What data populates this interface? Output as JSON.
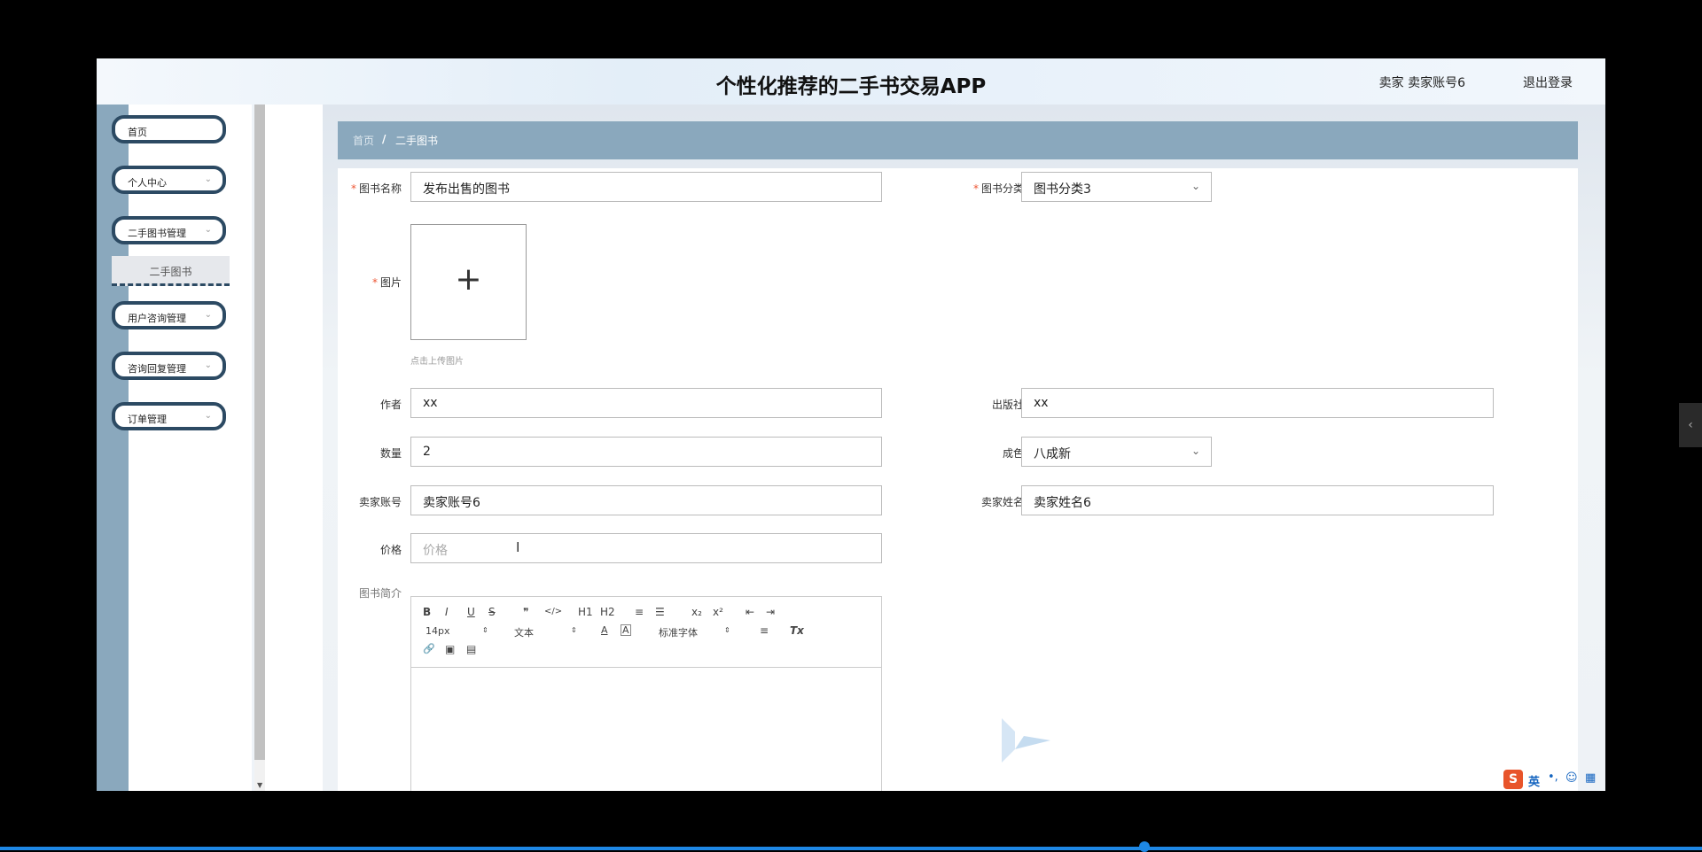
{
  "header": {
    "title": "个性化推荐的二手书交易APP",
    "user_info": "卖家 卖家账号6",
    "logout": "退出登录"
  },
  "sidebar": {
    "items": [
      {
        "label": "首页",
        "has_chevron": false
      },
      {
        "label": "个人中心",
        "has_chevron": true
      },
      {
        "label": "二手图书管理",
        "has_chevron": true
      },
      {
        "label": "用户咨询管理",
        "has_chevron": true
      },
      {
        "label": "咨询回复管理",
        "has_chevron": true
      },
      {
        "label": "订单管理",
        "has_chevron": true
      }
    ],
    "submenu": {
      "label": "二手图书"
    },
    "chevron": "⌄"
  },
  "breadcrumb": {
    "home": "首页",
    "separator": "/",
    "current": "二手图书"
  },
  "form": {
    "book_name": {
      "label": "图书名称",
      "value": "发布出售的图书",
      "required": true
    },
    "category": {
      "label": "图书分类",
      "value": "图书分类3",
      "required": true
    },
    "image": {
      "label": "图片",
      "hint": "点击上传图片",
      "plus": "+",
      "required": true
    },
    "author": {
      "label": "作者",
      "value": "xx"
    },
    "publisher": {
      "label": "出版社",
      "value": "xx"
    },
    "quantity": {
      "label": "数量",
      "value": "2"
    },
    "condition": {
      "label": "成色",
      "value": "八成新"
    },
    "seller_account": {
      "label": "卖家账号",
      "value": "卖家账号6"
    },
    "seller_name": {
      "label": "卖家姓名",
      "value": "卖家姓名6"
    },
    "price": {
      "label": "价格",
      "placeholder": "价格"
    },
    "intro": {
      "label": "图书简介"
    },
    "required_mark": "*",
    "dropdown_icon": "⌄"
  },
  "editor": {
    "row1": [
      "B",
      "I",
      "U",
      "S",
      "❞",
      "</>",
      "H1",
      "H2",
      "≡",
      "☰",
      "x₂",
      "x²",
      "⇤",
      "⇥"
    ],
    "font_size": "14px",
    "text_type": "文本",
    "font_family": "标准字体",
    "caret": "⇕",
    "row2_icons": [
      "A",
      "A",
      "≡",
      "Tx"
    ],
    "row3": [
      "🔗",
      "▣",
      "▤"
    ]
  },
  "ime": {
    "label": "英"
  },
  "side_tab": "‹",
  "colors": {
    "sidebar_accent": "#2c4a63",
    "breadcrumb_bg": "#8aa8bd",
    "required": "#e53",
    "taskbar": "#1e88e5"
  }
}
